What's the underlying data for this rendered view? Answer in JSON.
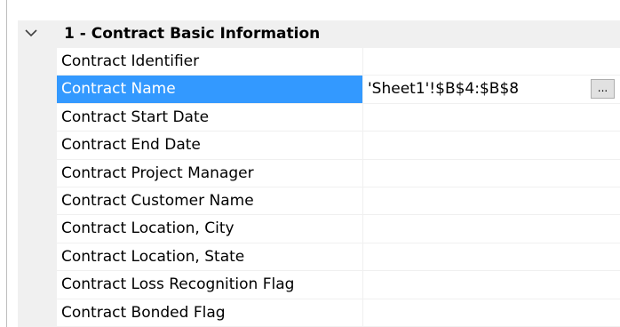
{
  "category": {
    "title": "1 - Contract Basic Information",
    "icon": "chevron-down-icon"
  },
  "properties": [
    {
      "name": "Contract Identifier",
      "value": ""
    },
    {
      "name": "Contract Name",
      "value": "'Sheet1'!$B$4:$B$8",
      "selected": true,
      "button_label": "..."
    },
    {
      "name": "Contract Start Date",
      "value": ""
    },
    {
      "name": "Contract End Date",
      "value": ""
    },
    {
      "name": "Contract Project Manager",
      "value": ""
    },
    {
      "name": "Contract Customer Name",
      "value": ""
    },
    {
      "name": "Contract Location, City",
      "value": ""
    },
    {
      "name": "Contract Location, State",
      "value": ""
    },
    {
      "name": "Contract Loss Recognition Flag",
      "value": ""
    },
    {
      "name": "Contract Bonded Flag",
      "value": ""
    }
  ],
  "colors": {
    "selection": "#3399ff",
    "category_background": "#f0f0f0"
  }
}
